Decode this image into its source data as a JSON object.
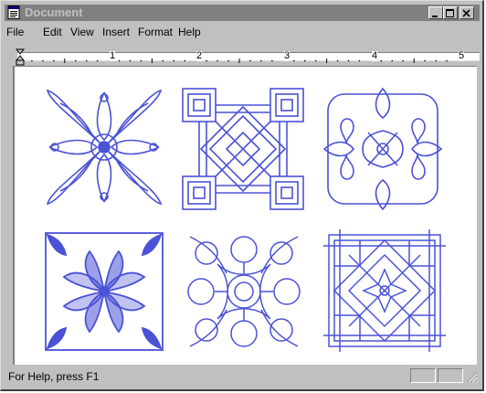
{
  "window": {
    "title": "Document",
    "icon": "document-icon"
  },
  "menubar": {
    "items": [
      "File",
      "Edit",
      "View",
      "Insert",
      "Format",
      "Help"
    ]
  },
  "ruler": {
    "labels": [
      "1",
      "2",
      "3",
      "4",
      "5"
    ]
  },
  "document": {
    "tiles": [
      "floral-star-ornament",
      "interlaced-square-knot-ornament",
      "heart-leaf-ornament",
      "tulip-ornament",
      "celtic-loop-ornament",
      "lattice-star-ornament"
    ],
    "ink_color": "#4a52d6"
  },
  "statusbar": {
    "help_text": "For Help, press F1"
  }
}
